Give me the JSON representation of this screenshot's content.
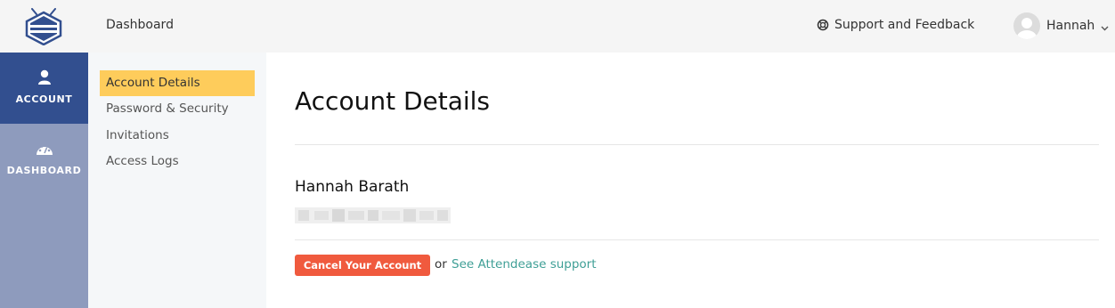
{
  "header": {
    "title": "Dashboard",
    "support_label": "Support and Feedback",
    "user_name": "Hannah"
  },
  "leftnav": {
    "items": [
      {
        "label": "ACCOUNT",
        "icon": "user-icon",
        "active": true
      },
      {
        "label": "DASHBOARD",
        "icon": "gauge-icon",
        "active": false
      }
    ]
  },
  "subnav": {
    "items": [
      {
        "label": "Account Details",
        "active": true
      },
      {
        "label": "Password & Security",
        "active": false
      },
      {
        "label": "Invitations",
        "active": false
      },
      {
        "label": "Access Logs",
        "active": false
      }
    ]
  },
  "main": {
    "title": "Account Details",
    "full_name": "Hannah Barath",
    "cancel_label": "Cancel Your Account",
    "or_text": "or",
    "support_link": "See Attendease support"
  },
  "colors": {
    "topbar": "#f5f5f5",
    "leftnav": "#8e9bbd",
    "leftnav_active": "#324f8f",
    "subnav_active": "#fecc5b",
    "cancel": "#f05a3e",
    "link": "#3f9f96"
  }
}
